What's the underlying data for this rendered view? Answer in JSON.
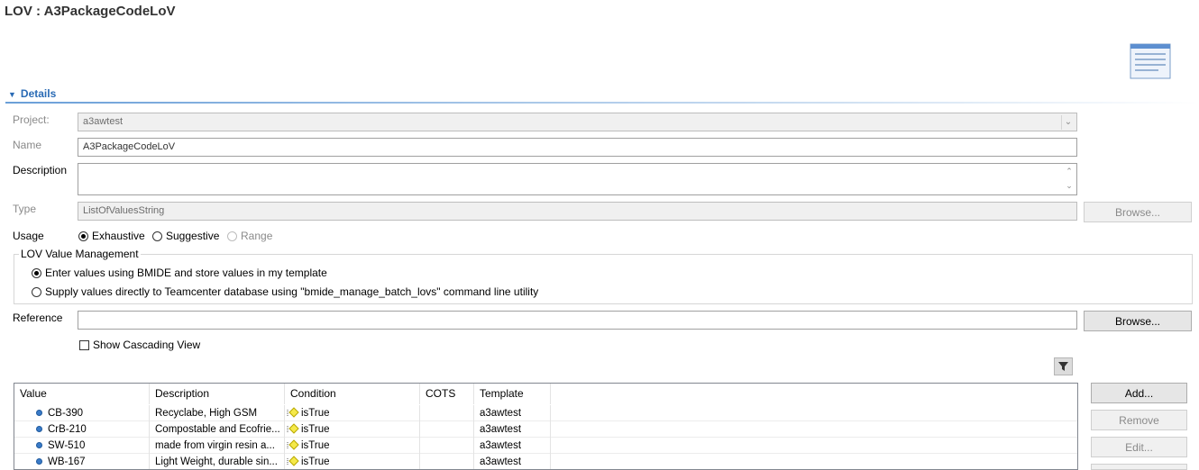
{
  "title": "LOV : A3PackageCodeLoV",
  "header_icon": "list-document-icon",
  "details": {
    "section_label": "Details",
    "project_label": "Project:",
    "project_value": "a3awtest",
    "name_label": "Name",
    "name_value": "A3PackageCodeLoV",
    "description_label": "Description",
    "description_value": "",
    "type_label": "Type",
    "type_value": "ListOfValuesString",
    "type_browse": "Browse...",
    "usage_label": "Usage",
    "usage_options": [
      "Exhaustive",
      "Suggestive",
      "Range"
    ],
    "usage_selected": "Exhaustive"
  },
  "value_management": {
    "title": "LOV Value Management",
    "option_bmide": "Enter values using BMIDE and store values in my template",
    "option_db": "Supply values directly to Teamcenter database using \"bmide_manage_batch_lovs\" command line utility"
  },
  "reference": {
    "label": "Reference",
    "value": "",
    "browse": "Browse..."
  },
  "cascading": {
    "label": "Show Cascading View",
    "checked": false
  },
  "table": {
    "headers": [
      "Value",
      "Description",
      "Condition",
      "COTS",
      "Template"
    ],
    "rows": [
      {
        "value": "CB-390",
        "description": "Recyclabe, High GSM",
        "condition": "isTrue",
        "cots": "",
        "template": "a3awtest"
      },
      {
        "value": "CrB-210",
        "description": "Compostable and Ecofrie...",
        "condition": "isTrue",
        "cots": "",
        "template": "a3awtest"
      },
      {
        "value": "SW-510",
        "description": "made from virgin resin a...",
        "condition": "isTrue",
        "cots": "",
        "template": "a3awtest"
      },
      {
        "value": "WB-167",
        "description": "Light Weight, durable sin...",
        "condition": "isTrue",
        "cots": "",
        "template": "a3awtest"
      }
    ]
  },
  "side_buttons": {
    "add": "Add...",
    "remove": "Remove",
    "edit": "Edit..."
  },
  "colors": {
    "accent": "#2a6bb5",
    "value_dot": "#3a7bc8",
    "condition_diamond": "#f5e94a"
  }
}
